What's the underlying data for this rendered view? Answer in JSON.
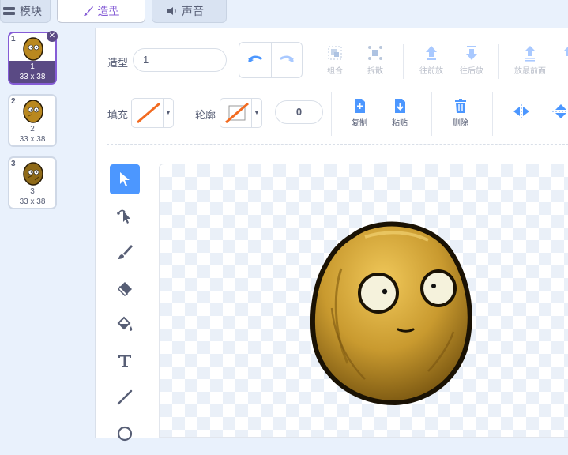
{
  "tabs": [
    {
      "label": "模块",
      "icon": "code-blocks-icon"
    },
    {
      "label": "造型",
      "icon": "paintbrush-icon"
    },
    {
      "label": "声音",
      "icon": "speaker-icon"
    }
  ],
  "costumes": [
    {
      "index": "1",
      "name": "1",
      "size": "33 x 38",
      "selected": true
    },
    {
      "index": "2",
      "name": "2",
      "size": "33 x 38",
      "selected": false
    },
    {
      "index": "3",
      "name": "3",
      "size": "33 x 38",
      "selected": false
    }
  ],
  "editor": {
    "costume_label": "造型",
    "costume_name": "1",
    "fill_label": "填充",
    "outline_label": "轮廓",
    "outline_width": "0",
    "toolbar": {
      "group": "组合",
      "ungroup": "拆散",
      "forward": "往前放",
      "backward": "往后放",
      "front": "放最前面",
      "copy": "复制",
      "paste": "粘贴",
      "delete": "删除"
    }
  },
  "colors": {
    "accent": "#855cd6",
    "selected_costume_bar": "#5a4a84",
    "tool_selected": "#4c97ff",
    "fill_line": "#f26b21"
  },
  "tools": [
    "select-icon",
    "reshape-icon",
    "brush-icon",
    "eraser-icon",
    "fill-icon",
    "text-icon",
    "line-icon",
    "circle-icon"
  ]
}
